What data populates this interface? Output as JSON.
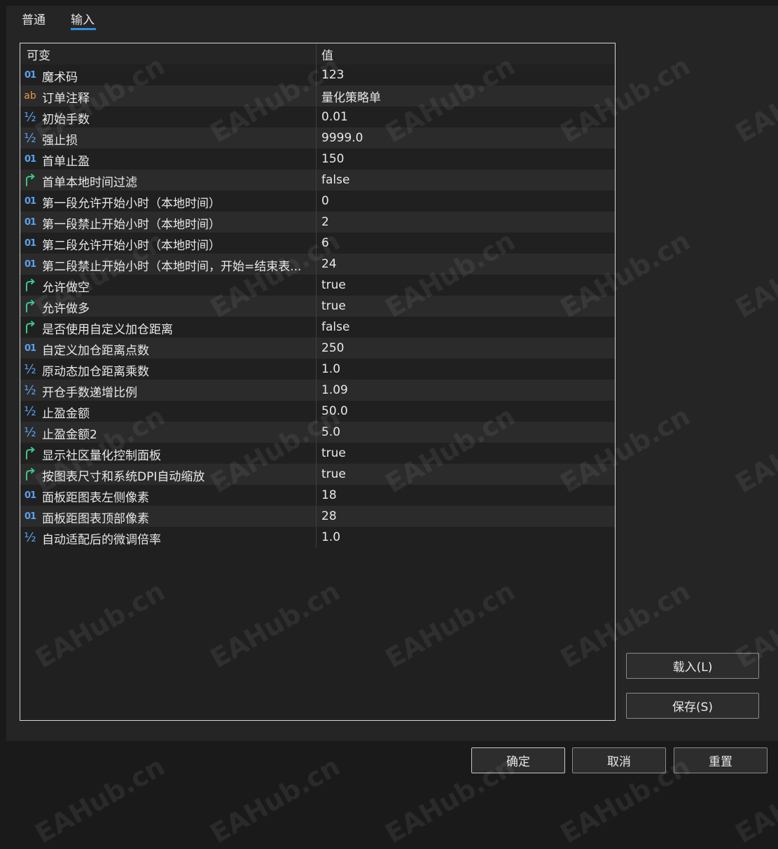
{
  "tabs": {
    "general": "普通",
    "inputs": "输入"
  },
  "table": {
    "header": {
      "name": "可变",
      "value": "值"
    },
    "rows": [
      {
        "type": "int",
        "name": "魔术码",
        "value": "123"
      },
      {
        "type": "string",
        "name": "订单注释",
        "value": "量化策略单"
      },
      {
        "type": "double",
        "name": "初始手数",
        "value": "0.01"
      },
      {
        "type": "double",
        "name": "强止损",
        "value": "9999.0"
      },
      {
        "type": "int",
        "name": "首单止盈",
        "value": "150"
      },
      {
        "type": "bool",
        "name": "首单本地时间过滤",
        "value": "false"
      },
      {
        "type": "int",
        "name": "第一段允许开始小时（本地时间）",
        "value": "0"
      },
      {
        "type": "int",
        "name": "第一段禁止开始小时（本地时间）",
        "value": "2"
      },
      {
        "type": "int",
        "name": "第二段允许开始小时（本地时间）",
        "value": "6"
      },
      {
        "type": "int",
        "name": "第二段禁止开始小时（本地时间，开始=结束表...",
        "value": "24"
      },
      {
        "type": "bool",
        "name": "允许做空",
        "value": "true"
      },
      {
        "type": "bool",
        "name": "允许做多",
        "value": "true"
      },
      {
        "type": "bool",
        "name": "是否使用自定义加仓距离",
        "value": "false"
      },
      {
        "type": "int",
        "name": "自定义加仓距离点数",
        "value": "250"
      },
      {
        "type": "double",
        "name": "原动态加仓距离乘数",
        "value": "1.0"
      },
      {
        "type": "double",
        "name": "开仓手数递增比例",
        "value": "1.09"
      },
      {
        "type": "double",
        "name": "止盈金额",
        "value": "50.0"
      },
      {
        "type": "double",
        "name": "止盈金额2",
        "value": "5.0"
      },
      {
        "type": "bool",
        "name": "显示社区量化控制面板",
        "value": "true"
      },
      {
        "type": "bool",
        "name": "按图表尺寸和系统DPI自动缩放",
        "value": "true"
      },
      {
        "type": "int",
        "name": "面板距图表左侧像素",
        "value": "18"
      },
      {
        "type": "int",
        "name": "面板距图表顶部像素",
        "value": "28"
      },
      {
        "type": "double",
        "name": "自动适配后的微调倍率",
        "value": "1.0"
      }
    ]
  },
  "icons": {
    "int": "01",
    "string": "ab",
    "double": "½",
    "bool": "bool-arrow-icon"
  },
  "colors": {
    "accent": "#2f8fe0",
    "int_icon": "#5aa2f0",
    "string_icon": "#e59a4a",
    "bool_icon": "#3ec48a"
  },
  "buttons": {
    "load": "载入(L)",
    "save": "保存(S)",
    "ok": "确定",
    "cancel": "取消",
    "reset": "重置"
  },
  "watermark": "EAHub.cn"
}
